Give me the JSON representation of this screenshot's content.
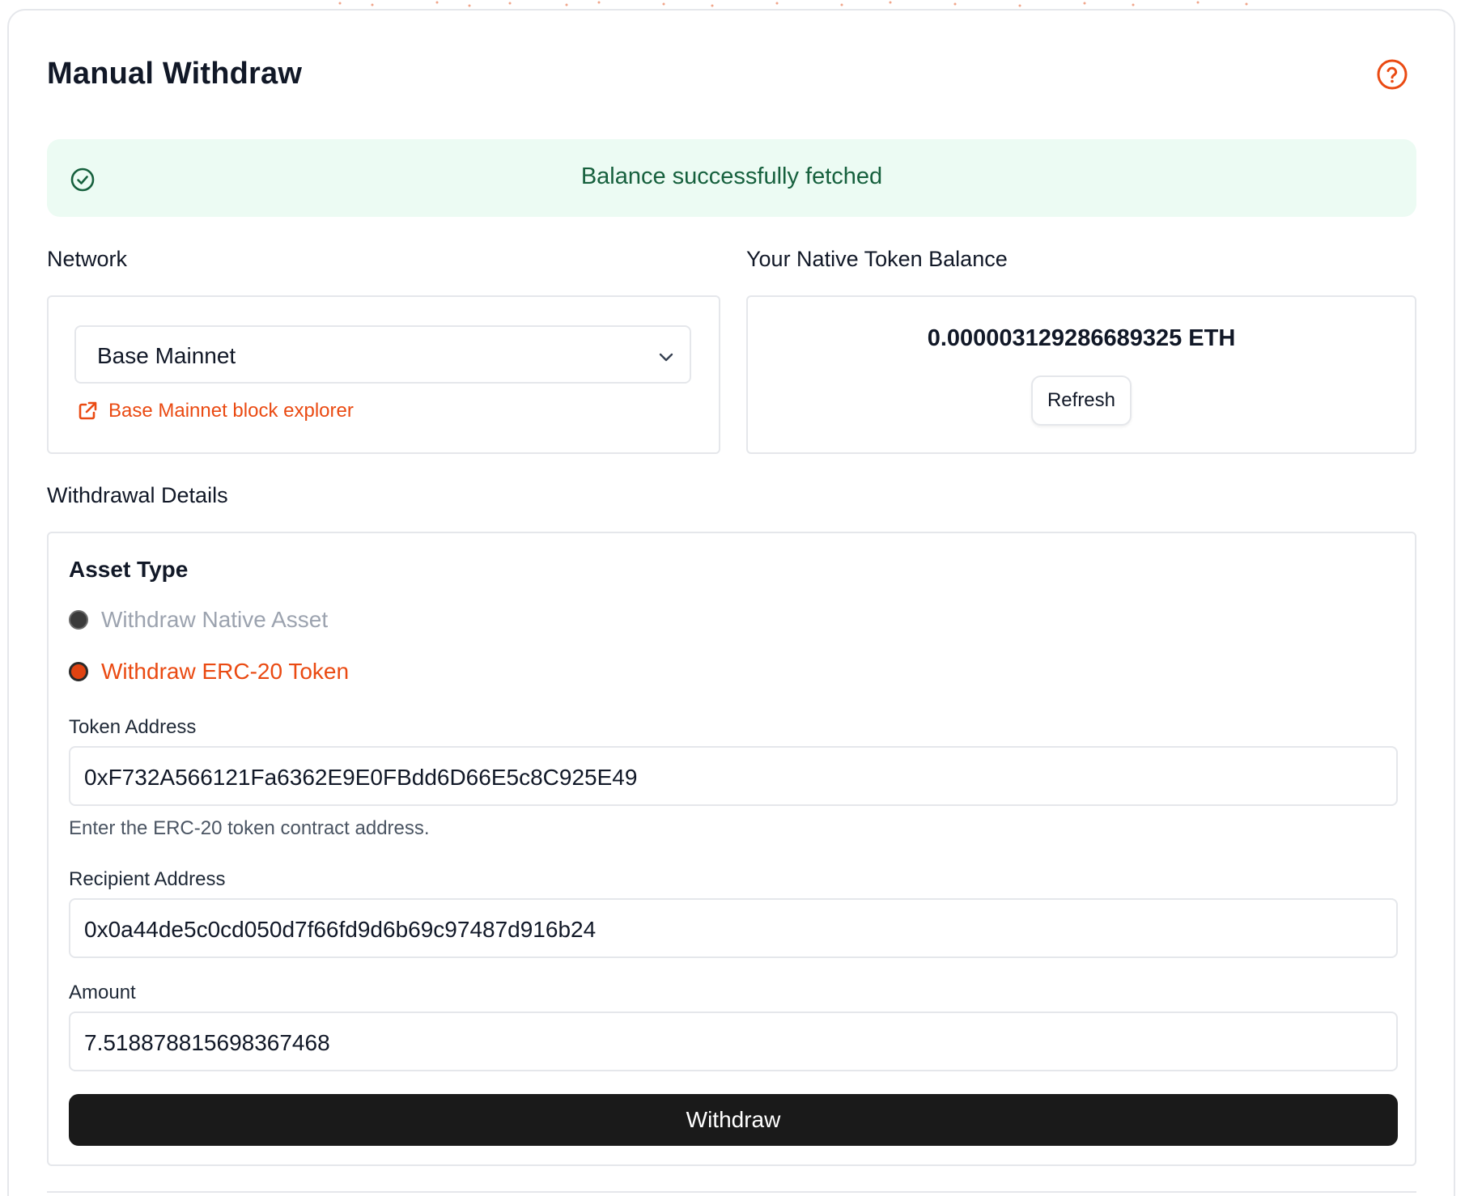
{
  "header": {
    "title": "Manual Withdraw",
    "help_icon": "question-circle-icon"
  },
  "alert": {
    "icon": "check-circle-icon",
    "message": "Balance successfully fetched"
  },
  "network": {
    "label": "Network",
    "selected": "Base Mainnet",
    "explorer_link": "Base Mainnet block explorer",
    "explorer_icon": "external-link-icon"
  },
  "balance": {
    "label": "Your Native Token Balance",
    "value": "0.000003129286689325 ETH",
    "refresh_label": "Refresh"
  },
  "withdrawal": {
    "label": "Withdrawal Details",
    "asset_type_label": "Asset Type",
    "options": [
      {
        "label": "Withdraw Native Asset",
        "selected": false
      },
      {
        "label": "Withdraw ERC-20 Token",
        "selected": true
      }
    ],
    "token_address": {
      "label": "Token Address",
      "value": "0xF732A566121Fa6362E9E0FBdd6D66E5c8C925E49",
      "hint": "Enter the ERC-20 token contract address."
    },
    "recipient_address": {
      "label": "Recipient Address",
      "value": "0x0a44de5c0cd050d7f66fd9d6b69c97487d916b24"
    },
    "amount": {
      "label": "Amount",
      "value": "7.518878815698367468"
    },
    "submit_label": "Withdraw"
  },
  "colors": {
    "accent": "#ea4a12",
    "success_bg": "#ecfbf3",
    "success_text": "#16603d",
    "button_dark": "#1a1a1a"
  }
}
